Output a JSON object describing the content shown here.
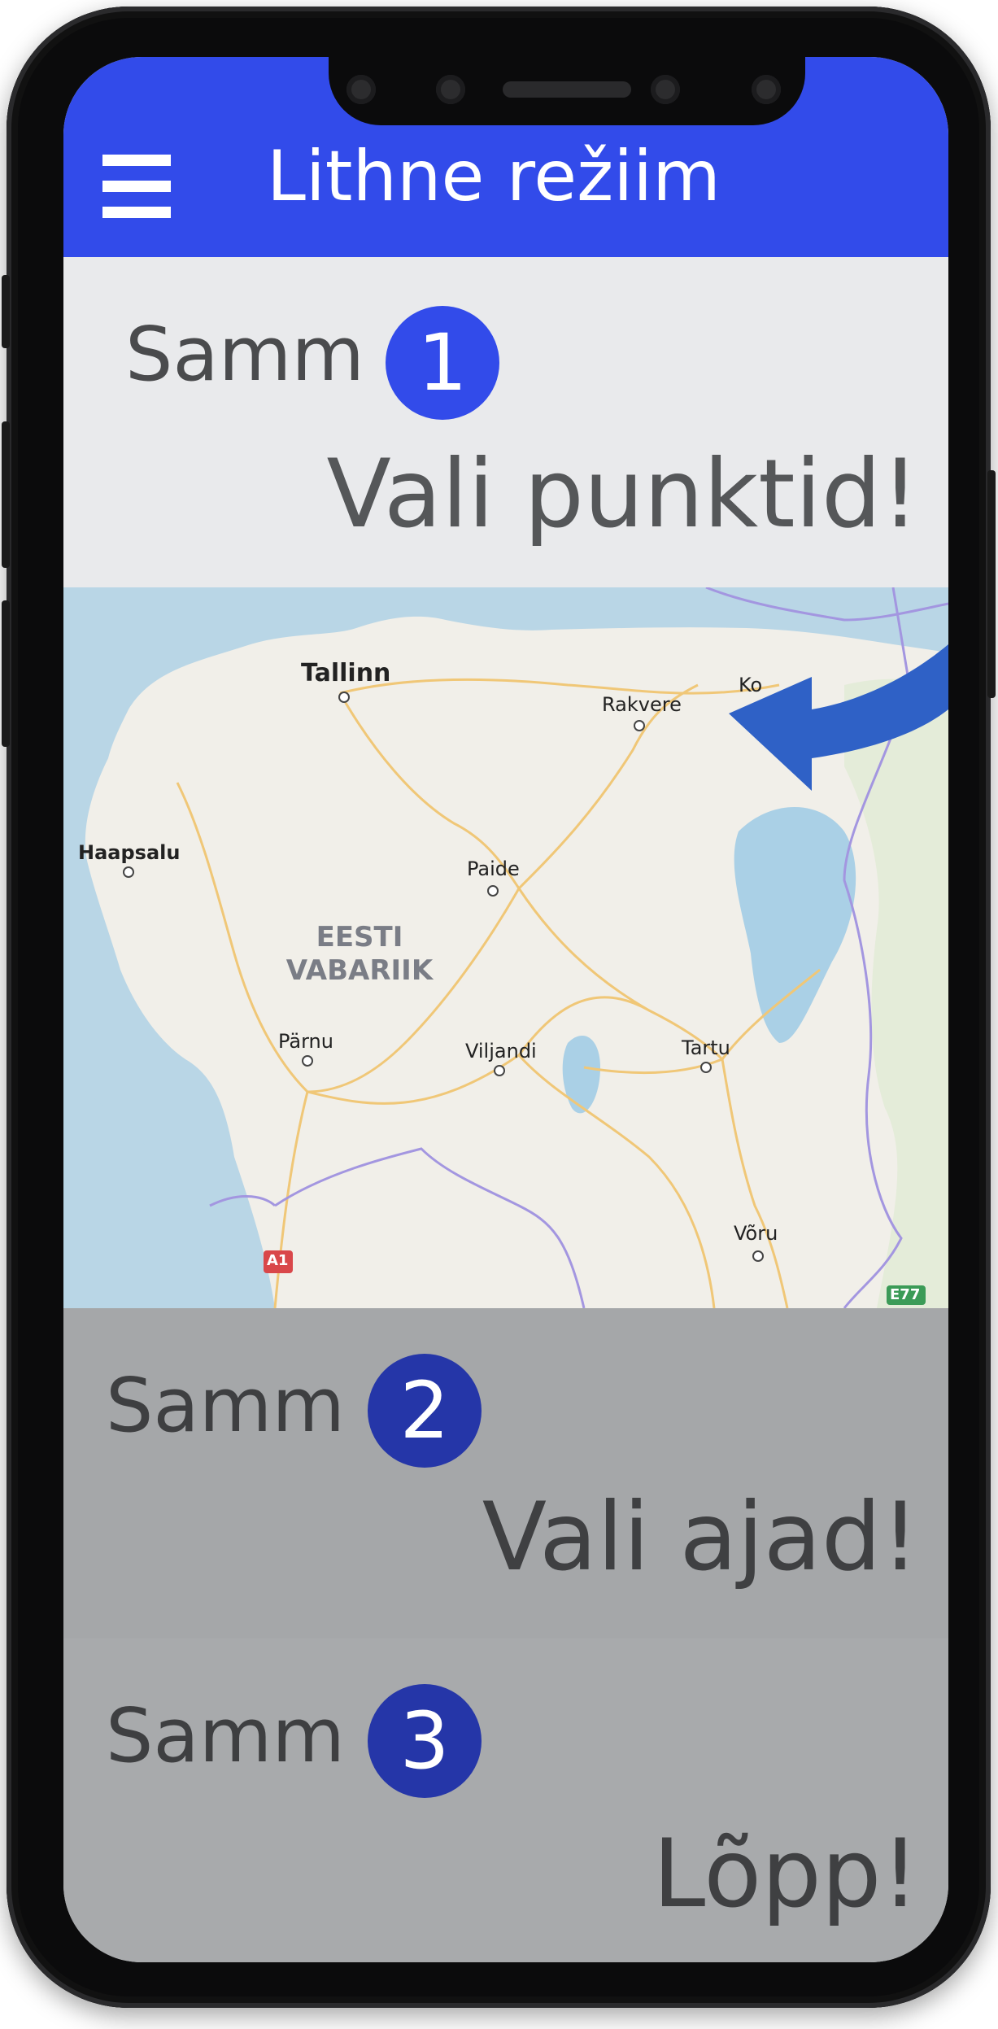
{
  "header": {
    "title": "Lithne režiim",
    "menu_icon": "hamburger-menu-icon",
    "color": "#324bea"
  },
  "steps": [
    {
      "label": "Samm",
      "number": "1",
      "text": "Vali punktid!",
      "badge_color": "#324bea",
      "state": "active"
    },
    {
      "label": "Samm",
      "number": "2",
      "text": "Vali ajad!",
      "badge_color": "#2536a8",
      "state": "inactive"
    },
    {
      "label": "Samm",
      "number": "3",
      "text": "Lõpp!",
      "badge_color": "#2536a8",
      "state": "inactive"
    }
  ],
  "map": {
    "country": "EESTI VABARIIK",
    "cities": [
      "Tallinn",
      "Rakvere",
      "Haapsalu",
      "Paide",
      "Pärnu",
      "Viljandi",
      "Tartu",
      "Võru",
      "Ko"
    ],
    "road_signs": [
      "A1",
      "E77"
    ],
    "arrow_icon": "curved-arrow-icon"
  }
}
